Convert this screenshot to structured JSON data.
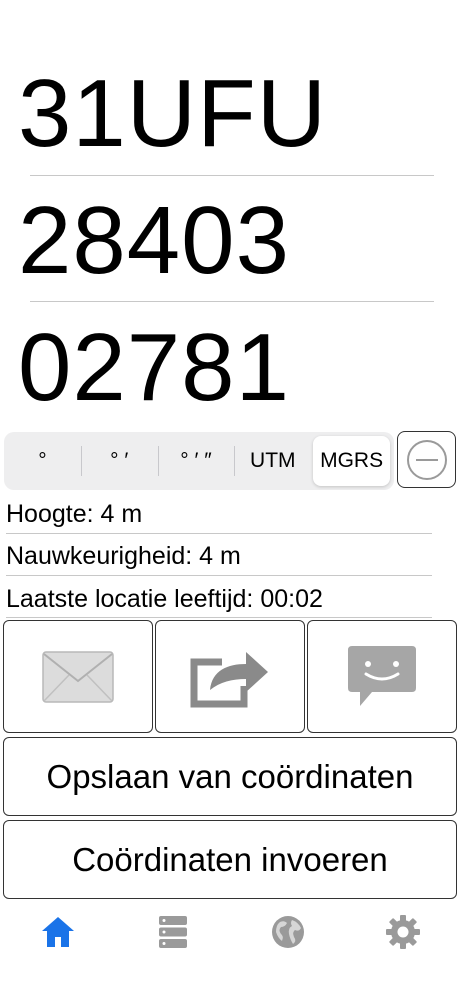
{
  "mgrs": {
    "zone_square": "31UFU",
    "easting": "28403",
    "northing": "02781"
  },
  "format_selector": {
    "options": [
      "°",
      "° ′",
      "° ′ ″",
      "UTM",
      "MGRS"
    ],
    "selected": "MGRS"
  },
  "info": {
    "altitude": "Hoogte: 4 m",
    "accuracy": "Nauwkeurigheid: 4 m",
    "location_age": "Laatste locatie leeftijd: 00:02"
  },
  "share_buttons": {
    "email_icon": "envelope-icon",
    "share_icon": "share-arrow-icon",
    "message_icon": "chat-bubble-icon"
  },
  "actions": {
    "save_label": "Opslaan van coördinaten",
    "input_label": "Coördinaten invoeren"
  },
  "tabbar": {
    "items": [
      "home-icon",
      "database-icon",
      "globe-icon",
      "gear-icon"
    ],
    "active": "home-icon"
  },
  "colors": {
    "accent": "#1a73e8",
    "inactive_icon": "#9a9a9a",
    "button_icon": "#a6a6a6"
  }
}
